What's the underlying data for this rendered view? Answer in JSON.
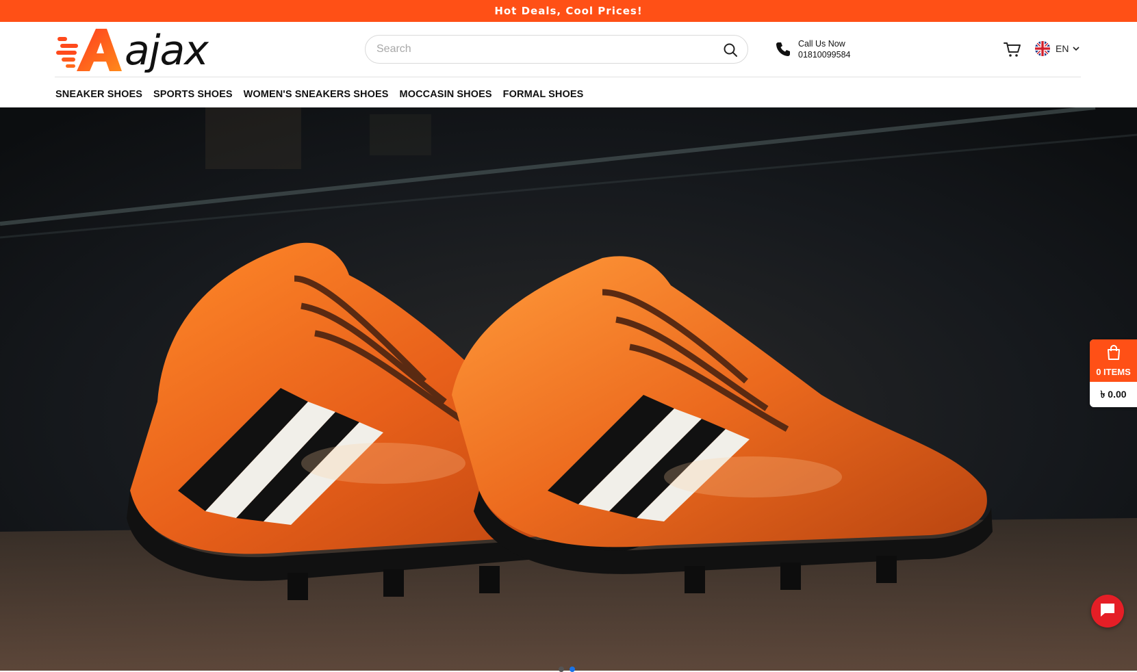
{
  "announcement": {
    "text": "Hot Deals, Cool Prices!"
  },
  "header": {
    "logo_text": "ajax",
    "search": {
      "placeholder": "Search",
      "value": ""
    },
    "call": {
      "label": "Call Us Now",
      "number": "01810099584"
    },
    "language": {
      "code": "EN"
    }
  },
  "nav": {
    "items": [
      {
        "label": "SNEAKER SHOES"
      },
      {
        "label": "SPORTS SHOES"
      },
      {
        "label": "WOMEN'S SNEAKERS SHOES"
      },
      {
        "label": "MOCCASIN SHOES"
      },
      {
        "label": "FORMAL SHOES"
      }
    ]
  },
  "hero": {
    "image": "orange football boots with black and white stripes",
    "active_slide": 2,
    "slide_count": 2
  },
  "side_cart": {
    "items_label": "0 ITEMS",
    "total": "৳ 0.00"
  },
  "colors": {
    "brand": "#ff5016",
    "chat": "#e51e26",
    "active_dot": "#1a73e8"
  },
  "icons": {
    "search": "search-icon",
    "phone": "phone-icon",
    "cart": "cart-icon",
    "flag": "uk-flag-icon",
    "chevron": "chevron-down-icon",
    "bag": "shopping-bag-icon",
    "chat": "chat-icon"
  }
}
